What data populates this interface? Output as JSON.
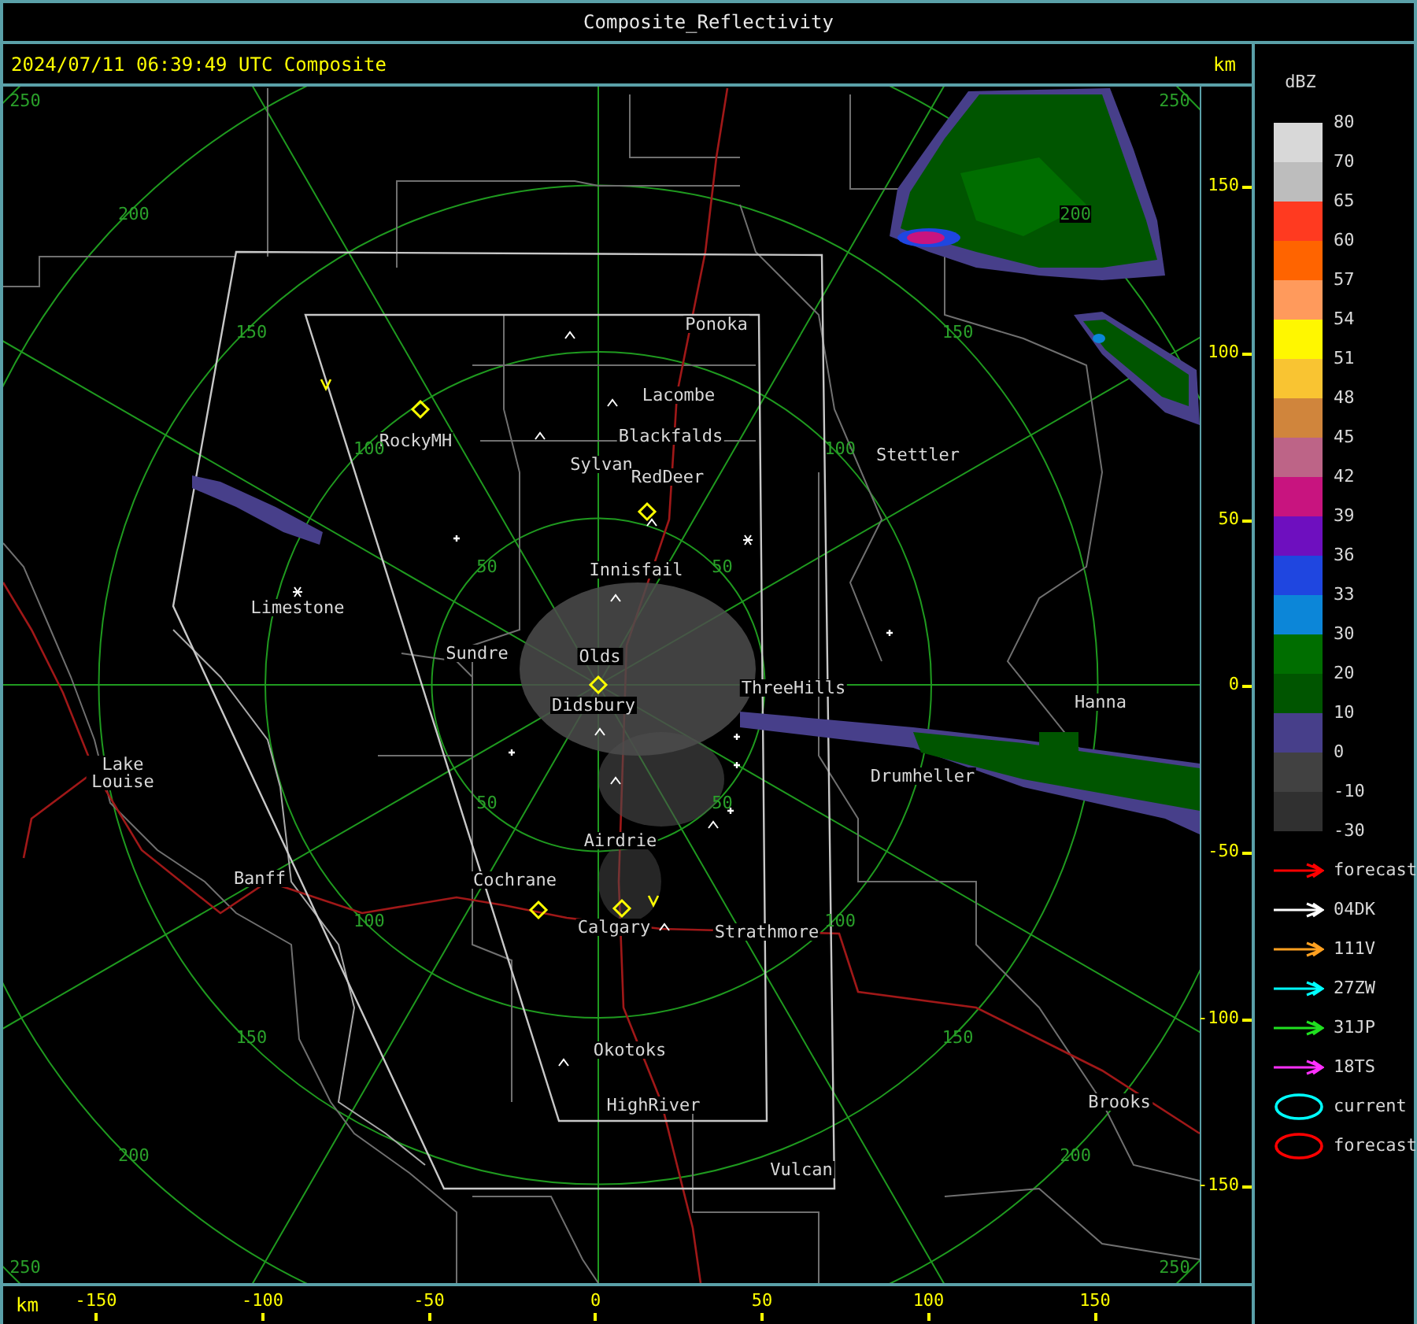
{
  "window": {
    "title": "Composite_Reflectivity"
  },
  "header": {
    "timestamp": "2024/07/11 06:39:49 UTC Composite",
    "unit": "km"
  },
  "map": {
    "cities": [
      {
        "name": "Ponoka"
      },
      {
        "name": "Lacombe"
      },
      {
        "name": "Blackfalds"
      },
      {
        "name": "Sylvan"
      },
      {
        "name": "RedDeer"
      },
      {
        "name": "Stettler"
      },
      {
        "name": "RockyMH"
      },
      {
        "name": "Innisfail"
      },
      {
        "name": "Limestone"
      },
      {
        "name": "Sundre"
      },
      {
        "name": "Olds"
      },
      {
        "name": "Didsbury"
      },
      {
        "name": "ThreeHills"
      },
      {
        "name": "Hanna"
      },
      {
        "name": "Drumheller"
      },
      {
        "name": "Lake Louise"
      },
      {
        "name": "Airdrie"
      },
      {
        "name": "Banff"
      },
      {
        "name": "Cochrane"
      },
      {
        "name": "Calgary"
      },
      {
        "name": "Strathmore"
      },
      {
        "name": "Okotoks"
      },
      {
        "name": "HighRiver"
      },
      {
        "name": "Brooks"
      },
      {
        "name": "Vulcan"
      }
    ],
    "range_labels": [
      "50",
      "100",
      "150",
      "200",
      "250",
      "50",
      "100",
      "150",
      "200",
      "250",
      "50",
      "100",
      "150",
      "200",
      "250",
      "50",
      "100",
      "150",
      "200",
      "250"
    ]
  },
  "y_axis": {
    "ticks": [
      "150",
      "100",
      "50",
      "0",
      "-50",
      "-100",
      "-150"
    ]
  },
  "x_axis": {
    "unit": "km",
    "ticks": [
      "-150",
      "-100",
      "-50",
      "0",
      "50",
      "100",
      "150"
    ]
  },
  "legend": {
    "title": "dBZ",
    "levels": [
      "80",
      "70",
      "65",
      "60",
      "57",
      "54",
      "51",
      "48",
      "45",
      "42",
      "39",
      "36",
      "33",
      "30",
      "20",
      "10",
      "0",
      "-10",
      "-30"
    ],
    "bins": [
      {
        "color": "#d8d8d8"
      },
      {
        "color": "#bdbdbd"
      },
      {
        "color": "#ff3a20"
      },
      {
        "color": "#ff6400"
      },
      {
        "color": "#ff9a5c"
      },
      {
        "color": "#fff700"
      },
      {
        "color": "#f9c432"
      },
      {
        "color": "#d0853c"
      },
      {
        "color": "#bd6487"
      },
      {
        "color": "#c8147f"
      },
      {
        "color": "#6e0fbf"
      },
      {
        "color": "#1f46e0"
      },
      {
        "color": "#0c86d8"
      },
      {
        "color": "#006e00"
      },
      {
        "color": "#005500"
      },
      {
        "color": "#473f8a"
      },
      {
        "color": "#414141"
      },
      {
        "color": "#303030"
      }
    ],
    "tracks": [
      {
        "kind": "arrow",
        "label": "forecast",
        "color": "#ff0000"
      },
      {
        "kind": "arrow",
        "label": "04DK",
        "color": "#ffffff"
      },
      {
        "kind": "arrow",
        "label": "111V",
        "color": "#ffa020"
      },
      {
        "kind": "arrow",
        "label": "27ZW",
        "color": "#00ffff"
      },
      {
        "kind": "arrow",
        "label": "31JP",
        "color": "#20e020"
      },
      {
        "kind": "arrow",
        "label": "18TS",
        "color": "#ff30ff"
      },
      {
        "kind": "ellipse",
        "label": "current",
        "color": "#00ffff"
      },
      {
        "kind": "ellipse",
        "label": "forecast",
        "color": "#ff0000"
      }
    ]
  }
}
